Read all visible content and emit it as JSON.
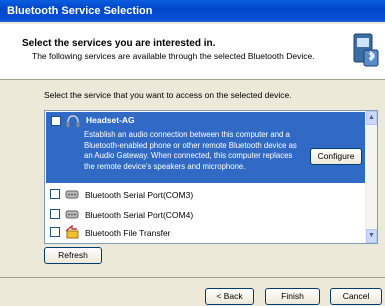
{
  "window": {
    "title": "Bluetooth Service Selection"
  },
  "header": {
    "title": "Select the services you are interested in.",
    "subtitle": "The following services are available through the selected Bluetooth Device.",
    "icon": "bluetooth-wizard-icon"
  },
  "instructions": "Select the service that you want to access on the selected device.",
  "services": [
    {
      "name": "Headset-AG",
      "icon": "headset-icon",
      "checked": false,
      "selected": true,
      "description": "Establish an audio connection between this computer and a Bluetooth-enabled phone or other remote Bluetooth device as an Audio Gateway. When connected, this computer replaces the remote device's speakers and microphone."
    },
    {
      "name": "Bluetooth Serial Port(COM3)",
      "icon": "serial-port-icon",
      "checked": false
    },
    {
      "name": "Bluetooth Serial Port(COM4)",
      "icon": "serial-port-icon",
      "checked": false
    },
    {
      "name": "Bluetooth File Transfer",
      "icon": "file-transfer-icon",
      "checked": false
    }
  ],
  "buttons": {
    "configure": "Configure",
    "refresh": "Refresh",
    "back": "< Back",
    "finish": "Finish",
    "cancel": "Cancel"
  },
  "colors": {
    "selection": "#316ac5",
    "titlebar": "#0054e3",
    "face": "#ece9d8"
  }
}
